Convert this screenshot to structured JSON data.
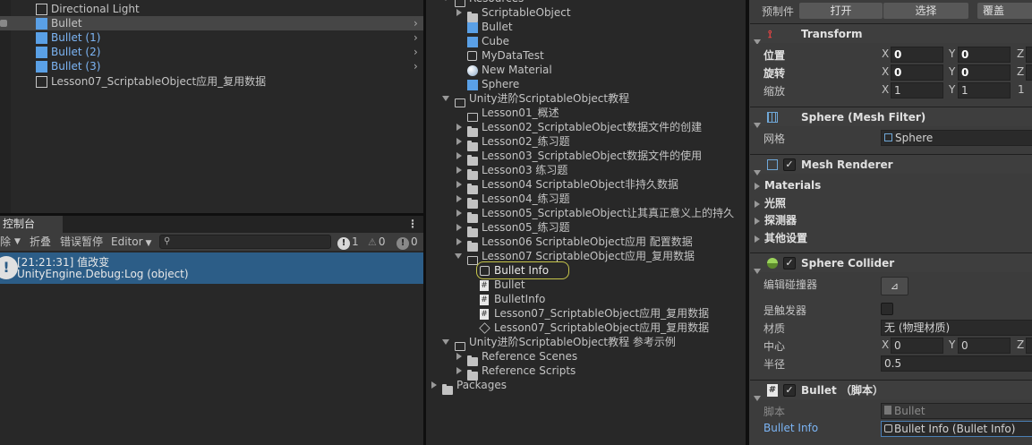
{
  "hierarchy": {
    "items": [
      {
        "label": "Directional Light",
        "color": "#c4c4c4"
      },
      {
        "label": "Bullet",
        "color": "#c4c4c4"
      },
      {
        "label": "Bullet (1)",
        "color": "#7cb5f5"
      },
      {
        "label": "Bullet (2)",
        "color": "#7cb5f5"
      },
      {
        "label": "Bullet (3)",
        "color": "#7cb5f5"
      },
      {
        "label": "Lesson07_ScriptableObject应用_复用数据",
        "color": "#c4c4c4"
      }
    ]
  },
  "console": {
    "tab_label": "控制台",
    "clear_label": "除",
    "collapse_label": "折叠",
    "error_pause_label": "错误暂停",
    "editor_label": "Editor",
    "search_placeholder": "",
    "info_count": "1",
    "warn_count": "0",
    "error_count": "0",
    "log_line1": "[21:21:31] 值改变",
    "log_line2": "UnityEngine.Debug:Log (object)"
  },
  "project": {
    "items": [
      {
        "label": "Resources"
      },
      {
        "label": "ScriptableObject"
      },
      {
        "label": "Bullet"
      },
      {
        "label": "Cube"
      },
      {
        "label": "MyDataTest"
      },
      {
        "label": "New Material"
      },
      {
        "label": "Sphere"
      },
      {
        "label": "Unity进阶ScriptableObject教程"
      },
      {
        "label": "Lesson01_概述"
      },
      {
        "label": "Lesson02_ScriptableObject数据文件的创建"
      },
      {
        "label": "Lesson02_练习题"
      },
      {
        "label": "Lesson03_ScriptableObject数据文件的使用"
      },
      {
        "label": "Lesson03 练习题"
      },
      {
        "label": "Lesson04 ScriptableObject非持久数据"
      },
      {
        "label": "Lesson04_练习题"
      },
      {
        "label": "Lesson05_ScriptableObject让其真正意义上的持久"
      },
      {
        "label": "Lesson05_练习题"
      },
      {
        "label": "Lesson06 ScriptableObject应用 配置数据"
      },
      {
        "label": "Lesson07 ScriptableObject应用_复用数据"
      },
      {
        "label": "Bullet Info"
      },
      {
        "label": "Bullet"
      },
      {
        "label": "BulletInfo"
      },
      {
        "label": "Lesson07_ScriptableObject应用_复用数据"
      },
      {
        "label": "Lesson07_ScriptableObject应用_复用数据"
      },
      {
        "label": "Unity进阶ScriptableObject教程 参考示例"
      },
      {
        "label": "Reference Scenes"
      },
      {
        "label": "Reference Scripts"
      },
      {
        "label": "Packages"
      }
    ]
  },
  "inspector": {
    "prefab_label": "预制件",
    "open_label": "打开",
    "select_label": "选择",
    "override_label": "覆盖",
    "transform": {
      "title": "Transform",
      "position_label": "位置",
      "rotation_label": "旋转",
      "scale_label": "缩放",
      "x": "X",
      "y": "Y",
      "z": "Z",
      "pos_x": "0",
      "pos_y": "0",
      "rot_x": "0",
      "rot_y": "0",
      "scale_x": "1",
      "scale_y": "1",
      "scale_z_partial": "1"
    },
    "mesh_filter": {
      "title": "Sphere (Mesh Filter)",
      "mesh_label": "网格",
      "mesh_value": "Sphere"
    },
    "mesh_renderer": {
      "title": "Mesh Renderer",
      "materials": "Materials",
      "lighting": "光照",
      "probes": "探测器",
      "additional": "其他设置"
    },
    "sphere_collider": {
      "title": "Sphere Collider",
      "edit_label": "编辑碰撞器",
      "trigger_label": "是触发器",
      "material_label": "材质",
      "material_value": "无 (物理材质)",
      "center_label": "中心",
      "center_x": "0",
      "center_y": "0",
      "radius_label": "半径",
      "radius_value": "0.5"
    },
    "bullet_script": {
      "title": "Bullet （脚本）",
      "script_label": "脚本",
      "script_value": "Bullet",
      "bullet_info_label": "Bullet Info",
      "bullet_info_value": "Bullet Info (Bullet Info)"
    }
  },
  "colors": {
    "selection": "#2c5d87",
    "accent_blue": "#7cb5f5",
    "highlight_ring": "#c6c54a"
  }
}
